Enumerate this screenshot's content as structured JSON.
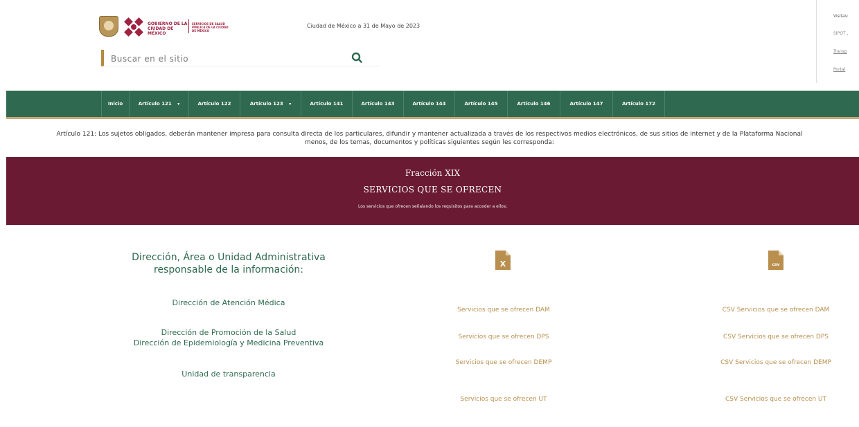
{
  "header": {
    "logo_text": "GOBIERNO DE LA CIUDAD DE MÉXICO",
    "logo_subtext": "SERVICIOS DE SALUD PÚBLICA DE LA CIUDAD DE MÉXICO",
    "date": "Ciudad de México a 31 de Mayo de 2023",
    "search": {
      "placeholder": "Buscar en el sitio"
    },
    "right_panel": {
      "visitas": "Visitas:",
      "sipot": "SIPOT ,",
      "transparencia": "Transp",
      "portal": "Portal"
    }
  },
  "nav": {
    "items": [
      {
        "label": "Inicio"
      },
      {
        "label": "Artículo 121",
        "dropdown": true
      },
      {
        "label": "Artículo 122"
      },
      {
        "label": "Artículo 123",
        "dropdown": true
      },
      {
        "label": "Artículo 141"
      },
      {
        "label": "Artículo 143"
      },
      {
        "label": "Artículo 144"
      },
      {
        "label": "Artículo 145"
      },
      {
        "label": "Artículo 146"
      },
      {
        "label": "Artículo 147"
      },
      {
        "label": "Artículo 172"
      }
    ]
  },
  "intro": {
    "line1": "Artículo 121: Los sujetos obligados, deberán mantener impresa para consulta directa de los particulares, difundir y mantener actualizada a través de los respectivos medios electrónicos, de sus sitios de internet y de la Plataforma Nacional",
    "line2": "menos, de los temas, documentos y políticas siguientes según les corresponda:"
  },
  "banner": {
    "fraccion": "Fracción XIX",
    "title": "SERVICIOS QUE SE OFRECEN",
    "subtitle": "Los servicios que ofrecen señalando los requisitos para acceder a ellos;"
  },
  "content": {
    "column_heading_line1": "Dirección, Área o Unidad Administrativa",
    "column_heading_line2": "responsable de la información:",
    "excel_icon_text": "X",
    "csv_icon_text": "csv",
    "departments": [
      "Dirección de Atención Médica",
      "Dirección de Promoción de la Salud",
      "Dirección de Epidemiología y Medicina Preventiva",
      "Unidad de transparencia"
    ],
    "excel_links": [
      "Servicios que se ofrecen DAM",
      "Servicios que se ofrecen DPS",
      "Servicios que se ofrecen DEMP",
      "Servicios que se ofrecen UT"
    ],
    "csv_links": [
      "CSV Servicios que se ofrecen DAM",
      "CSV Servicios que se ofrecen DPS",
      "CSV Servicios que se ofrecen DEMP",
      "CSV Servicios que se ofrecen UT"
    ]
  },
  "colors": {
    "brand_green": "#2f6950",
    "brand_wine": "#6a1b33",
    "brand_gold": "#b98f4e"
  }
}
